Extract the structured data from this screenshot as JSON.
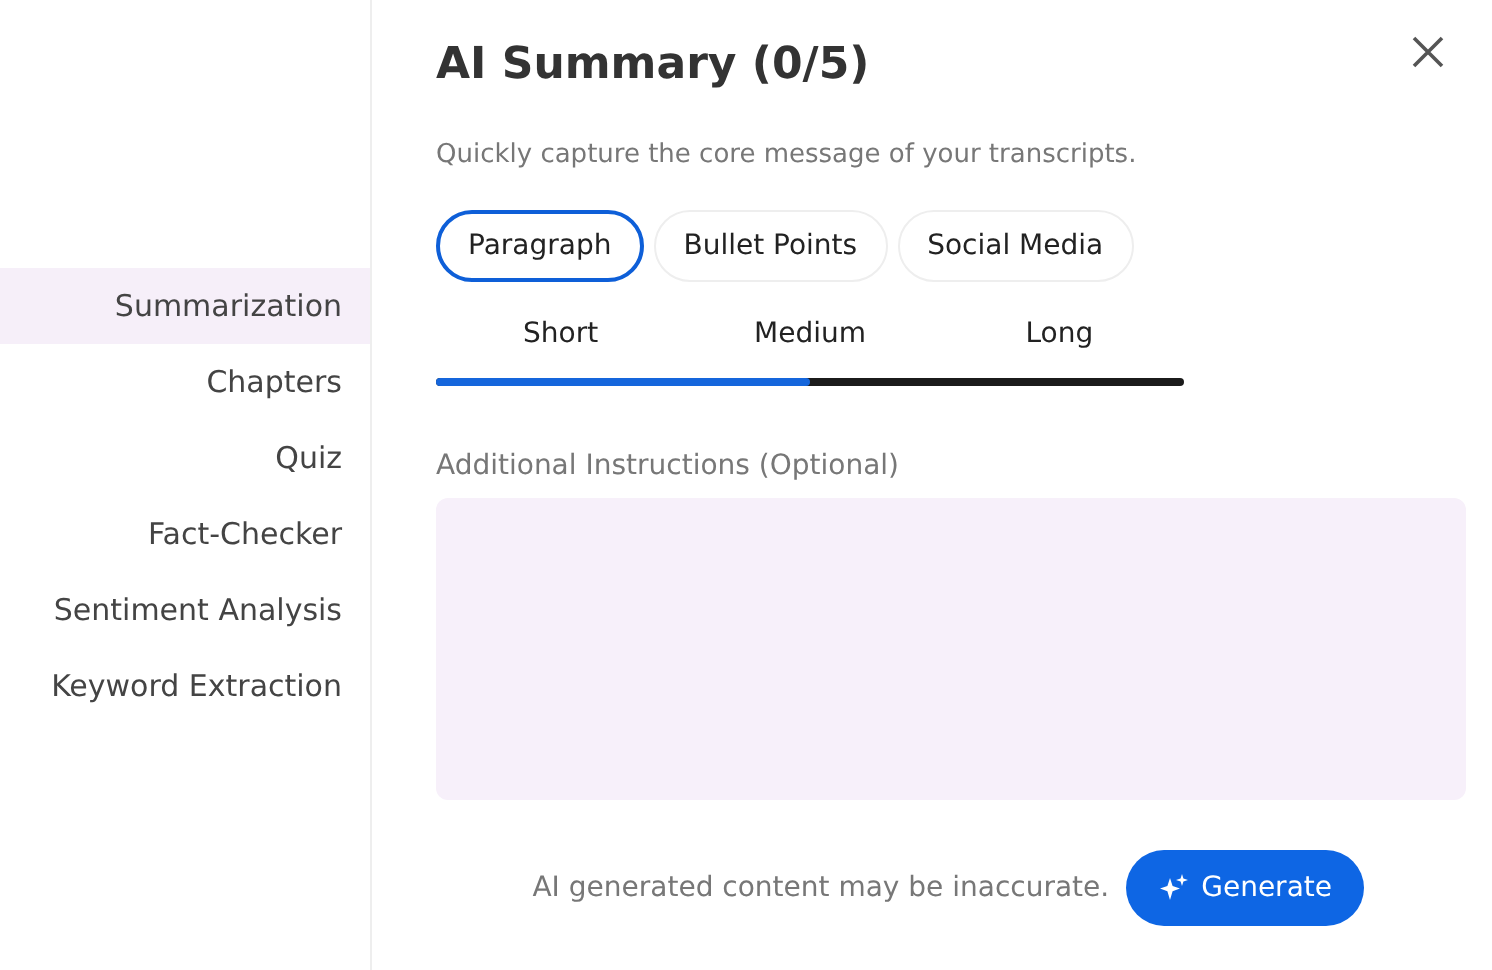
{
  "sidebar": {
    "items": [
      {
        "label": "Summarization",
        "selected": true
      },
      {
        "label": "Chapters",
        "selected": false
      },
      {
        "label": "Quiz",
        "selected": false
      },
      {
        "label": "Fact-Checker",
        "selected": false
      },
      {
        "label": "Sentiment Analysis",
        "selected": false
      },
      {
        "label": "Keyword Extraction",
        "selected": false
      }
    ]
  },
  "title": "AI Summary (0/5)",
  "subtitle": "Quickly capture the core message of your transcripts.",
  "formats": [
    {
      "label": "Paragraph",
      "selected": true
    },
    {
      "label": "Bullet Points",
      "selected": false
    },
    {
      "label": "Social Media",
      "selected": false
    }
  ],
  "length": {
    "options": [
      "Short",
      "Medium",
      "Long"
    ],
    "level": 0.5
  },
  "instructions": {
    "label": "Additional Instructions (Optional)"
  },
  "footer": {
    "disclaimer": "AI generated content may be inaccurate.",
    "button": "Generate"
  }
}
